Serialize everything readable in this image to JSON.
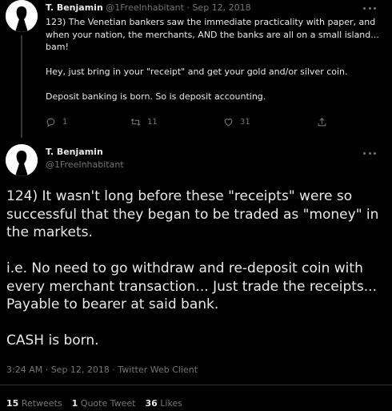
{
  "parent_tweet": {
    "author_name": "T. Benjamin",
    "author_handle": "@1FreeInhabitant",
    "separator": "·",
    "date": "Sep 12, 2018",
    "paragraphs": [
      "123) The Venetian bankers saw the immediate practicality with paper, and when your nation, the merchants, AND the banks are all on a small island... bam!",
      "Hey, just bring in your \"receipt\" and get your gold and/or silver coin.",
      "Deposit banking is born. So is deposit accounting."
    ],
    "reply_count": "1",
    "retweet_count": "11",
    "like_count": "31"
  },
  "main_tweet": {
    "author_name": "T. Benjamin",
    "author_handle": "@1FreeInhabitant",
    "paragraphs": [
      "124) It wasn't long before these \"receipts\" were so successful that they began to be traded as \"money\" in the markets.",
      "i.e. No need to go withdraw and re-deposit coin with every merchant transaction... Just trade the receipts... Payable to bearer at said bank.",
      "CASH is born."
    ],
    "timestamp": "3:24 AM · Sep 12, 2018 · Twitter Web Client",
    "stats": {
      "retweets_count": "15",
      "retweets_label": "Retweets",
      "quote_count": "1",
      "quote_label": "Quote Tweet",
      "likes_count": "36",
      "likes_label": "Likes"
    }
  },
  "icons": [
    "avatar-silhouette",
    "more-icon",
    "reply-icon",
    "retweet-icon",
    "like-icon",
    "share-icon"
  ],
  "colors": {
    "background": "#000000",
    "text": "#e7e9ea",
    "muted": "#71767b",
    "divider": "#2f3336"
  }
}
